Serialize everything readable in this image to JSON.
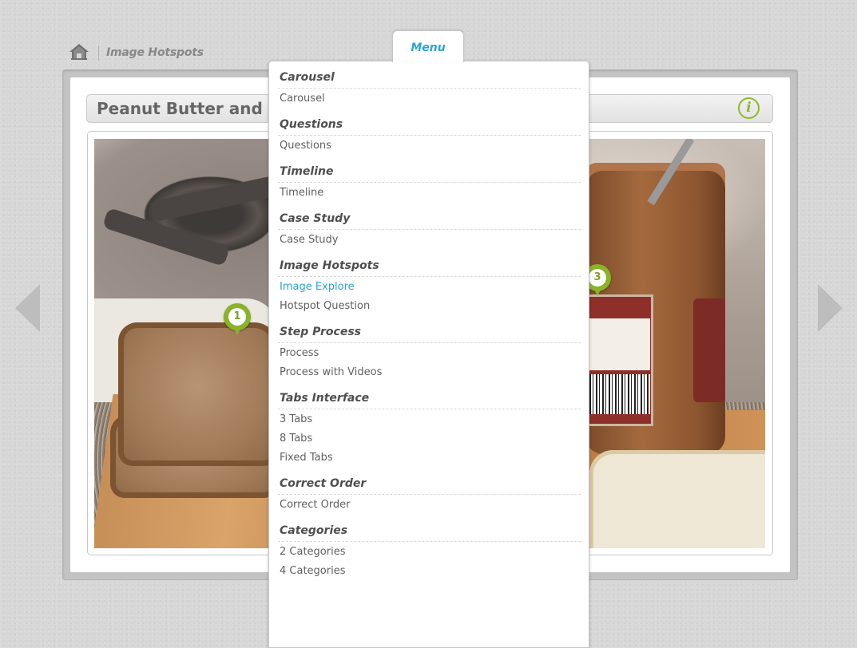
{
  "header": {
    "breadcrumb_title": "Image Hotspots",
    "menu_tab_label": "Menu"
  },
  "content": {
    "page_title": "Peanut Butter and",
    "info_icon_glyph": "i",
    "hotspots": [
      {
        "label": "1"
      },
      {
        "label": "3"
      }
    ]
  },
  "menu": {
    "sections": [
      {
        "heading": "Carousel",
        "items": [
          "Carousel"
        ]
      },
      {
        "heading": "Questions",
        "items": [
          "Questions"
        ]
      },
      {
        "heading": "Timeline",
        "items": [
          "Timeline"
        ]
      },
      {
        "heading": "Case Study",
        "items": [
          "Case Study"
        ]
      },
      {
        "heading": "Image Hotspots",
        "items": [
          "Image Explore",
          "Hotspot Question"
        ],
        "active": "Image Explore"
      },
      {
        "heading": "Step Process",
        "items": [
          "Process",
          "Process with Videos"
        ]
      },
      {
        "heading": "Tabs Interface",
        "items": [
          "3 Tabs",
          "8 Tabs",
          "Fixed Tabs"
        ]
      },
      {
        "heading": "Correct Order",
        "items": [
          "Correct Order"
        ]
      },
      {
        "heading": "Categories",
        "items": [
          "2 Categories",
          "4 Categories"
        ]
      }
    ]
  },
  "colors": {
    "accent_blue": "#27a5d6",
    "hotspot_green": "#8ab22a",
    "info_green": "#8fb82b"
  },
  "icons": {
    "home": "home-icon",
    "info": "info-icon",
    "prev": "arrow-left-icon",
    "next": "arrow-right-icon"
  }
}
